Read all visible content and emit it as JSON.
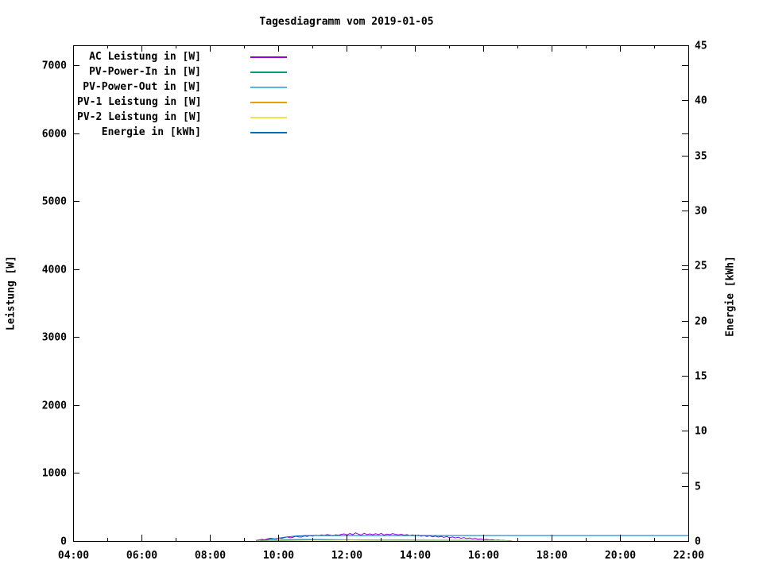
{
  "title": "Tagesdiagramm vom 2019-01-05",
  "chart_data": {
    "type": "line",
    "title": "Tagesdiagramm vom 2019-01-05",
    "background_color": "#ffffff",
    "grid": false,
    "legend_position": "top-left-inside",
    "x_axis": {
      "label": "",
      "tick_labels": [
        "04:00",
        "06:00",
        "08:00",
        "10:00",
        "12:00",
        "14:00",
        "16:00",
        "18:00",
        "20:00",
        "22:00"
      ],
      "range_hours": [
        4,
        22
      ],
      "minor_tick_every_hours": 1
    },
    "y_axis_left": {
      "label": "Leistung [W]",
      "tick_values": [
        0,
        1000,
        2000,
        3000,
        4000,
        5000,
        6000,
        7000
      ],
      "range": [
        0,
        7290
      ]
    },
    "y_axis_right": {
      "label": "Energie [kWh]",
      "tick_values": [
        0,
        5,
        10,
        15,
        20,
        25,
        30,
        35,
        40,
        45
      ],
      "range": [
        0,
        45
      ]
    },
    "series": [
      {
        "name": "AC Leistung in [W]",
        "color": "#9400d3",
        "axis": "left",
        "sampling": {
          "start_hour": 9.35,
          "step_hours": 0.0833333
        },
        "values": [
          8,
          15,
          25,
          18,
          30,
          42,
          35,
          28,
          45,
          38,
          52,
          60,
          48,
          55,
          70,
          62,
          58,
          75,
          68,
          80,
          72,
          85,
          78,
          90,
          82,
          95,
          88,
          75,
          92,
          85,
          98,
          105,
          90,
          110,
          95,
          120,
          100,
          88,
          115,
          95,
          105,
          92,
          108,
          96,
          112,
          88,
          102,
          94,
          110,
          98,
          90,
          100,
          85,
          95,
          80,
          90,
          75,
          88,
          70,
          82,
          65,
          78,
          62,
          72,
          58,
          68,
          55,
          65,
          50,
          60,
          45,
          55,
          40,
          50,
          35,
          45,
          30,
          38,
          25,
          32,
          20,
          25,
          15,
          20,
          10,
          15,
          8,
          10,
          5,
          6,
          3
        ]
      },
      {
        "name": "PV-Power-In in [W]",
        "color": "#009e73",
        "axis": "left",
        "points": [
          [
            9.4,
            5
          ],
          [
            10.0,
            12
          ],
          [
            10.5,
            15
          ],
          [
            11.0,
            17
          ],
          [
            11.5,
            16
          ],
          [
            12.0,
            18
          ],
          [
            12.5,
            16
          ],
          [
            13.0,
            15
          ],
          [
            13.5,
            16
          ],
          [
            14.0,
            14
          ],
          [
            14.5,
            13
          ],
          [
            15.0,
            12
          ],
          [
            15.5,
            10
          ],
          [
            16.0,
            8
          ],
          [
            16.5,
            6
          ],
          [
            16.8,
            4
          ]
        ]
      },
      {
        "name": "PV-Power-Out in [W]",
        "color": "#56b4e9",
        "axis": "left",
        "points": [
          [
            9.7,
            10
          ],
          [
            10.2,
            22
          ],
          [
            10.7,
            26
          ],
          [
            11.2,
            24
          ],
          [
            11.8,
            20
          ],
          [
            12.4,
            16
          ],
          [
            13.0,
            14
          ],
          [
            13.6,
            13
          ],
          [
            14.2,
            12
          ],
          [
            14.8,
            11
          ],
          [
            15.4,
            10
          ],
          [
            16.0,
            8
          ],
          [
            16.7,
            5
          ]
        ]
      },
      {
        "name": "PV-1 Leistung in [W]",
        "color": "#e69f00",
        "axis": "left",
        "points": [
          [
            9.35,
            0
          ],
          [
            16.85,
            0
          ]
        ]
      },
      {
        "name": "PV-2 Leistung in [W]",
        "color": "#f0e442",
        "axis": "left",
        "points": [
          [
            9.35,
            0
          ],
          [
            16.85,
            0
          ]
        ]
      },
      {
        "name": "Energie in [kWh]",
        "color": "#0072b2",
        "axis": "right",
        "points": [
          [
            9.5,
            0.05
          ],
          [
            9.9,
            0.2
          ],
          [
            10.2,
            0.35
          ],
          [
            10.5,
            0.45
          ],
          [
            10.8,
            0.5
          ],
          [
            22.0,
            0.5
          ]
        ]
      }
    ]
  }
}
